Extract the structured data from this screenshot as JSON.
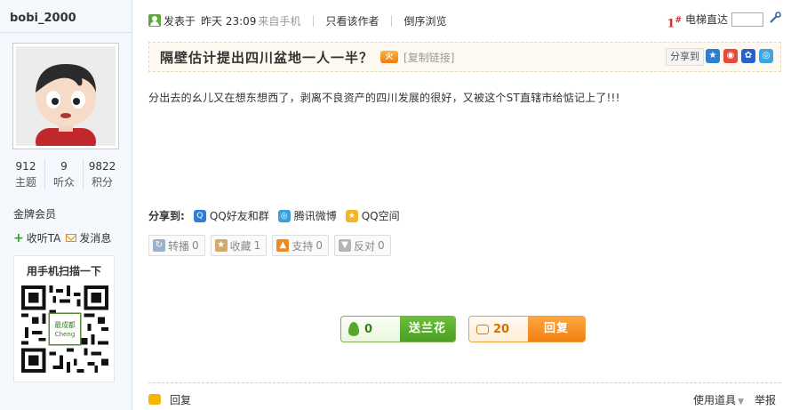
{
  "sidebar": {
    "username": "bobi_2000",
    "stats": [
      {
        "value": "912",
        "label": "主题"
      },
      {
        "value": "9",
        "label": "听众"
      },
      {
        "value": "9822",
        "label": "积分"
      }
    ],
    "member_level": "金牌会员",
    "follow_label": "收听TA",
    "message_label": "发消息",
    "qr_title": "用手机扫描一下"
  },
  "meta": {
    "posted_prefix": "发表于",
    "posted_time": "昨天 23:09",
    "source": "来自手机",
    "author_only": "只看该作者",
    "reverse_view": "倒序浏览",
    "floor_number": "1",
    "floor_mark": "#",
    "goto_label": "电梯直达",
    "goto_value": ""
  },
  "thread": {
    "title": "隔壁估计提出四川盆地一人一半？",
    "hot_badge": "火",
    "copy_link": "[复制链接]",
    "share_to": "分享到",
    "body": "分出去的幺儿又在想东想西了，剥离不良资产的四川发展的很好，又被这个ST直辖市给惦记上了!!!"
  },
  "share": {
    "label": "分享到:",
    "items": [
      "QQ好友和群",
      "腾讯微博",
      "QQ空间"
    ]
  },
  "actions": [
    {
      "label": "转播",
      "count": "0"
    },
    {
      "label": "收藏",
      "count": "1"
    },
    {
      "label": "支持",
      "count": "0"
    },
    {
      "label": "反对",
      "count": "0"
    }
  ],
  "flower": {
    "count": "0",
    "label": "送兰花"
  },
  "reply_box": {
    "count": "20",
    "label": "回复"
  },
  "bottom": {
    "reply": "回复",
    "tools": "使用道具",
    "report": "举报"
  },
  "colors": {
    "accent_green": "#4a9e22",
    "accent_orange": "#f08010",
    "floor_red": "#cc3333"
  }
}
